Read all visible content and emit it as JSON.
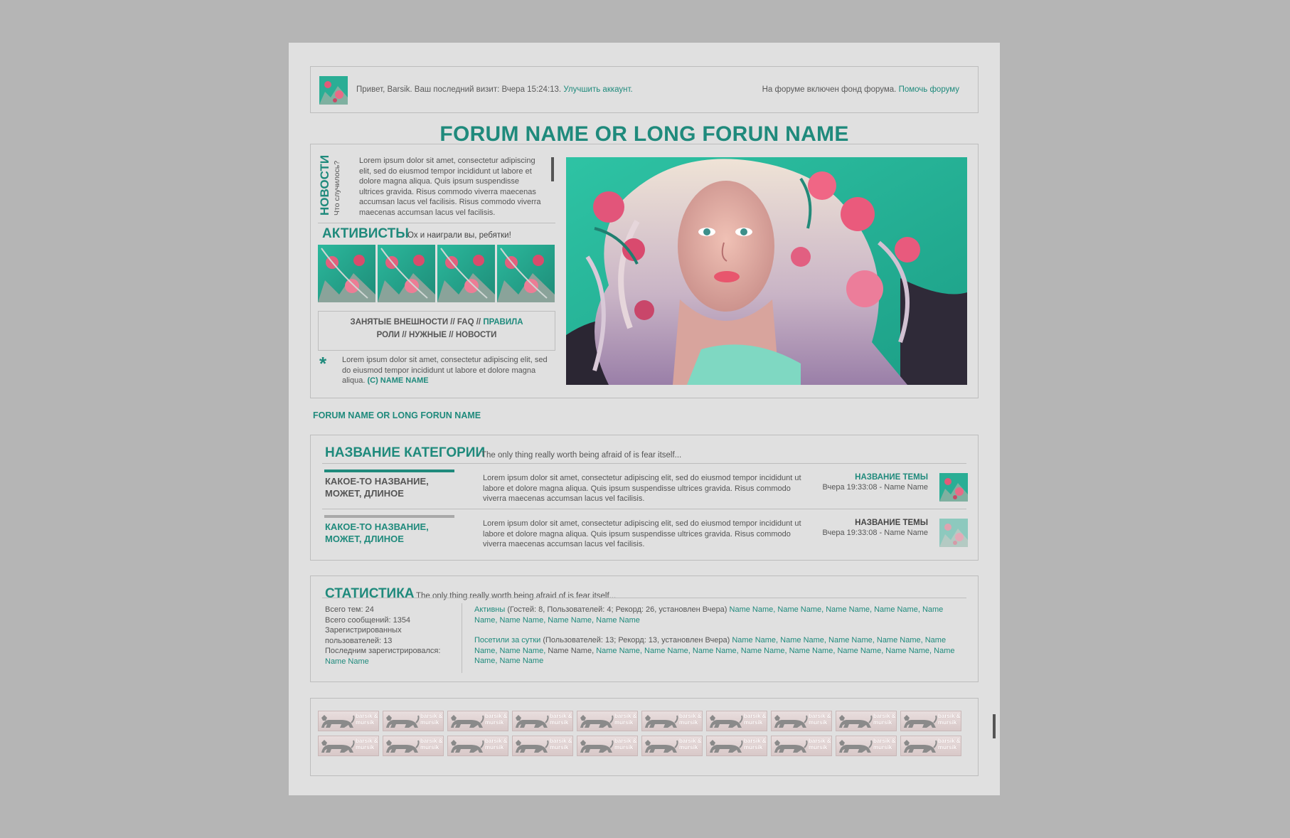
{
  "topbar": {
    "greeting": "Привет, Barsik. Ваш последний визит: Вчера 15:24:13.",
    "upgrade_link": "Улучшить аккаунт.",
    "fund_text": "На форуме включен фонд форума.",
    "fund_link": "Помочь форуму"
  },
  "forum_title": "FORUM NAME OR LONG FORUN NAME",
  "news": {
    "title": "НОВОСТИ",
    "subtitle": "Что случилось?",
    "text": "Lorem ipsum dolor sit amet, consectetur adipiscing elit, sed do eiusmod tempor incididunt ut labore et dolore magna aliqua. Quis ipsum suspendisse ultrices gravida. Risus commodo viverra maecenas accumsan lacus vel facilisis. Risus commodo viverra maecenas accumsan lacus vel facilisis."
  },
  "activists": {
    "title": "АКТИВИСТЫ",
    "subtitle": "Ох и наиграли вы, ребятки!"
  },
  "quicklinks": {
    "row1_a": "ЗАНЯТЫЕ ВНЕШНОСТИ // FAQ //",
    "row1_b": "ПРАВИЛА",
    "row2": "РОЛИ // НУЖНЫЕ // НОВОСТИ"
  },
  "quote": {
    "star": "*",
    "text": "Lorem ipsum dolor sit amet, consectetur adipiscing elit, sed do eiusmod tempor incididunt ut labore et dolore magna aliqua.",
    "author": "(C) NAME NAME"
  },
  "breadcrumb": "FORUM NAME OR LONG FORUN NAME",
  "category": {
    "title": "НАЗВАНИЕ КАТЕГОРИИ",
    "subtitle": "The only thing really worth being afraid of is fear itself...",
    "forums": [
      {
        "name": "КАКОЕ-ТО НАЗВАНИЕ, МОЖЕТ, ДЛИНОЕ",
        "desc": "Lorem ipsum dolor sit amet, consectetur adipiscing elit, sed do eiusmod tempor incididunt ut labore et dolore magna aliqua. Quis ipsum suspendisse ultrices gravida. Risus commodo viverra maecenas accumsan lacus vel facilisis.",
        "last_title": "НАЗВАНИЕ ТЕМЫ",
        "last_date": "Вчера 19:33:08 - Name Name"
      },
      {
        "name": "КАКОЕ-ТО НАЗВАНИЕ, МОЖЕТ, ДЛИНОЕ",
        "desc": "Lorem ipsum dolor sit amet, consectetur adipiscing elit, sed do eiusmod tempor incididunt ut labore et dolore magna aliqua. Quis ipsum suspendisse ultrices gravida. Risus commodo viverra maecenas accumsan lacus vel facilisis.",
        "last_title": "НАЗВАНИЕ ТЕМЫ",
        "last_date": "Вчера 19:33:08 - Name Name"
      }
    ]
  },
  "stats": {
    "title": "СТАТИСТИКА",
    "subtitle": "The only thing really worth being afraid of is fear itself...",
    "total_topics": "Всего тем: 24",
    "total_posts": "Всего сообщений: 1354",
    "registered": "Зарегистрированных пользователей: 13",
    "last_registered_label": "Последним зарегистрировался:",
    "last_registered_name": "Name Name",
    "active_label": "Активны",
    "active_info": "(Гостей: 8, Пользователей: 4; Рекорд: 26, установлен Вчера)",
    "active_names": "Name Name, Name Name,  Name Name,  Name Name,  Name Name, Name Name,  Name Name,  Name Name",
    "visited_label": "Посетили за сутки",
    "visited_info": "(Пользователей: 13; Рекорд: 13, установлен Вчера)",
    "visited_names_1": "Name Name, Name Name,  Name Name,  Name Name,  Name Name, Name Name,",
    "visited_plain": "Name Name,",
    "visited_names_2": "Name Name, Name Name, Name Name,  Name Name,  Name Name,  Name Name, Name Name,  Name Name,  Name Name"
  },
  "banners": {
    "label": "barsik & mursik",
    "count": 20
  },
  "colors": {
    "accent": "#1f8a7c",
    "page_bg": "#e0e0e0",
    "outer_bg": "#b5b5b5"
  }
}
